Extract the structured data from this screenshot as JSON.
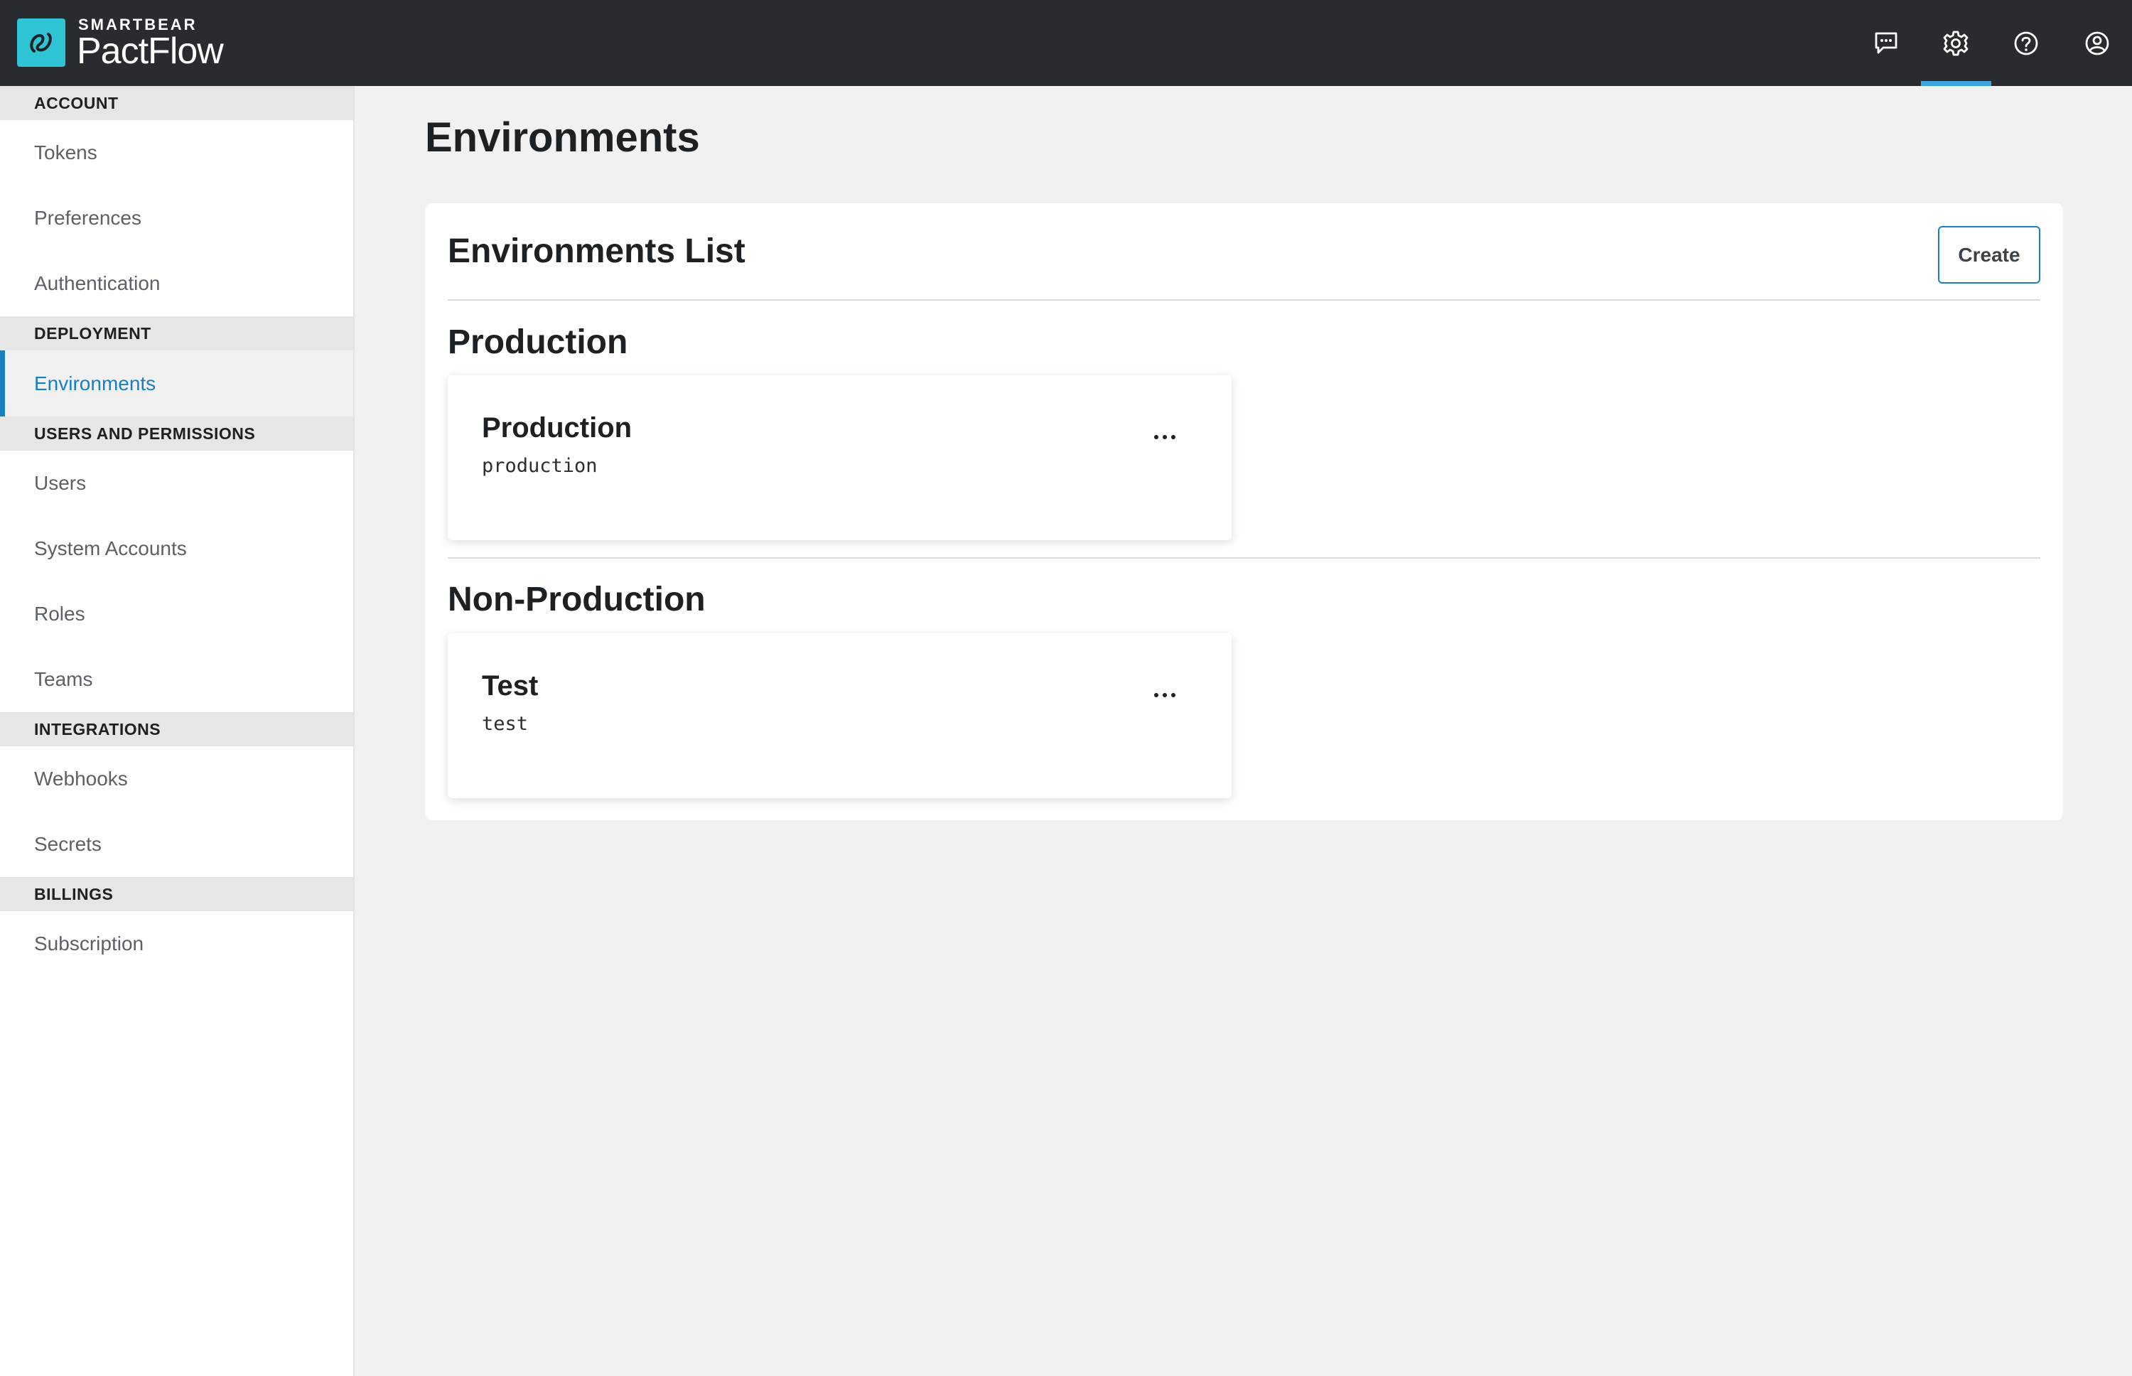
{
  "brand": {
    "company": "SMARTBEAR",
    "product": "PactFlow"
  },
  "topbar": {
    "icons": [
      "chat-feedback-icon",
      "gear-icon",
      "help-icon",
      "user-account-icon"
    ],
    "accent_color": "#3da6e0"
  },
  "sidebar": {
    "sections": [
      {
        "title": "ACCOUNT",
        "items": [
          {
            "label": "Tokens"
          },
          {
            "label": "Preferences"
          },
          {
            "label": "Authentication"
          }
        ]
      },
      {
        "title": "DEPLOYMENT",
        "items": [
          {
            "label": "Environments",
            "active": true
          }
        ]
      },
      {
        "title": "USERS AND PERMISSIONS",
        "items": [
          {
            "label": "Users"
          },
          {
            "label": "System Accounts"
          },
          {
            "label": "Roles"
          },
          {
            "label": "Teams"
          }
        ]
      },
      {
        "title": "INTEGRATIONS",
        "items": [
          {
            "label": "Webhooks"
          },
          {
            "label": "Secrets"
          }
        ]
      },
      {
        "title": "BILLINGS",
        "items": [
          {
            "label": "Subscription"
          }
        ]
      }
    ],
    "active_color": "#1a7fc1"
  },
  "main": {
    "page_title": "Environments",
    "panel": {
      "title": "Environments List",
      "create_label": "Create",
      "groups": [
        {
          "title": "Production",
          "environments": [
            {
              "name": "Production",
              "id": "production"
            }
          ]
        },
        {
          "title": "Non-Production",
          "environments": [
            {
              "name": "Test",
              "id": "test"
            }
          ]
        }
      ]
    }
  }
}
